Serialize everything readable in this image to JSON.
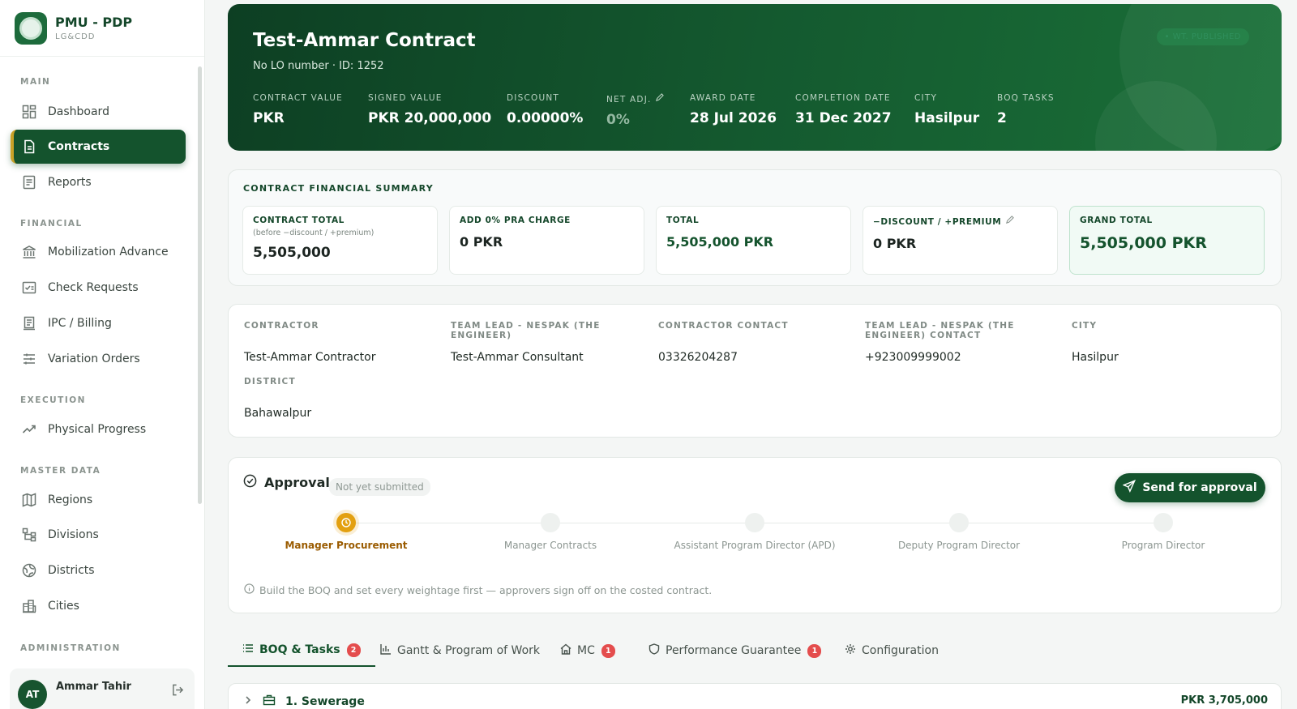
{
  "app": {
    "title": "PMU - PDP",
    "subtitle": "LG&CDD"
  },
  "sidebar": {
    "sections": [
      "MAIN",
      "FINANCIAL",
      "EXECUTION",
      "MASTER DATA",
      "ADMINISTRATION"
    ],
    "items": [
      {
        "label": "Dashboard",
        "icon": "grid-icon"
      },
      {
        "label": "Contracts",
        "icon": "document-icon",
        "active": true
      },
      {
        "label": "Reports",
        "icon": "report-icon"
      },
      {
        "label": "Mobilization Advance",
        "icon": "bank-icon"
      },
      {
        "label": "Check Requests",
        "icon": "check-request-icon"
      },
      {
        "label": "IPC / Billing",
        "icon": "billing-icon"
      },
      {
        "label": "Variation Orders",
        "icon": "sliders-icon"
      },
      {
        "label": "Physical Progress",
        "icon": "trend-icon"
      },
      {
        "label": "Regions",
        "icon": "map-icon"
      },
      {
        "label": "Divisions",
        "icon": "hierarchy-icon"
      },
      {
        "label": "Districts",
        "icon": "globe-icon"
      },
      {
        "label": "Cities",
        "icon": "city-icon"
      }
    ]
  },
  "user": {
    "initials": "AT",
    "name": "Ammar Tahir"
  },
  "contract": {
    "title": "Test-Ammar Contract",
    "subtitle": "No LO number  ·  ID: 1252",
    "status": "• WT. PUBLISHED",
    "stats": [
      {
        "label": "CONTRACT VALUE",
        "value": "PKR"
      },
      {
        "label": "SIGNED VALUE",
        "value": "PKR 20,000,000"
      },
      {
        "label": "DISCOUNT",
        "value": "0.00000%"
      },
      {
        "label": "NET ADJ.",
        "value": "0%"
      },
      {
        "label": "AWARD DATE",
        "value": "28 Jul 2026"
      },
      {
        "label": "COMPLETION DATE",
        "value": "31 Dec 2027"
      },
      {
        "label": "CITY",
        "value": "Hasilpur"
      },
      {
        "label": "BOQ TASKS",
        "value": "2"
      }
    ]
  },
  "financial": {
    "title": "CONTRACT FINANCIAL SUMMARY",
    "boxes": [
      {
        "label": "CONTRACT TOTAL",
        "note": "(before −discount / +premium)",
        "value": "5,505,000"
      },
      {
        "label": "ADD 0% PRA CHARGE",
        "note": "",
        "value": "0 PKR"
      },
      {
        "label": "TOTAL",
        "note": "",
        "value": "5,505,000 PKR"
      },
      {
        "label": "−DISCOUNT / +PREMIUM",
        "note": "",
        "value": "0 PKR"
      },
      {
        "label": "GRAND TOTAL",
        "note": "",
        "value": "5,505,000 PKR"
      }
    ]
  },
  "info": [
    {
      "label": "CONTRACTOR",
      "value": "Test-Ammar Contractor"
    },
    {
      "label": "TEAM LEAD - NESPAK (THE ENGINEER)",
      "value": "Test-Ammar Consultant"
    },
    {
      "label": "CONTRACTOR CONTACT",
      "value": "03326204287"
    },
    {
      "label": "TEAM LEAD - NESPAK (THE ENGINEER) CONTACT",
      "value": "+923009999002"
    },
    {
      "label": "CITY",
      "value": "Hasilpur"
    },
    {
      "label": "DISTRICT",
      "value": "Bahawalpur"
    }
  ],
  "approval": {
    "title": "Approval",
    "status": "Not yet submitted",
    "send_label": "Send for approval",
    "steps": [
      "Manager Procurement",
      "Manager Contracts",
      "Assistant Program Director (APD)",
      "Deputy Program Director",
      "Program Director"
    ],
    "current_step": 0,
    "hint": "Build the BOQ and set every weightage first — approvers sign off on the costed contract."
  },
  "tabs": [
    {
      "label": "BOQ & Tasks",
      "count": "2",
      "active": true
    },
    {
      "label": "Gantt & Program of Work",
      "count": ""
    },
    {
      "label": "MC",
      "count": "1"
    },
    {
      "label": "Performance Guarantee",
      "count": "1"
    },
    {
      "label": "Configuration",
      "count": ""
    }
  ],
  "boq": {
    "name": "1. Sewerage",
    "amount": "PKR 3,705,000"
  },
  "colors": {
    "primary": "#14532d",
    "accent_gold": "#c9a227",
    "step_current": "#e3a010",
    "badge_red": "#e44d4d"
  }
}
